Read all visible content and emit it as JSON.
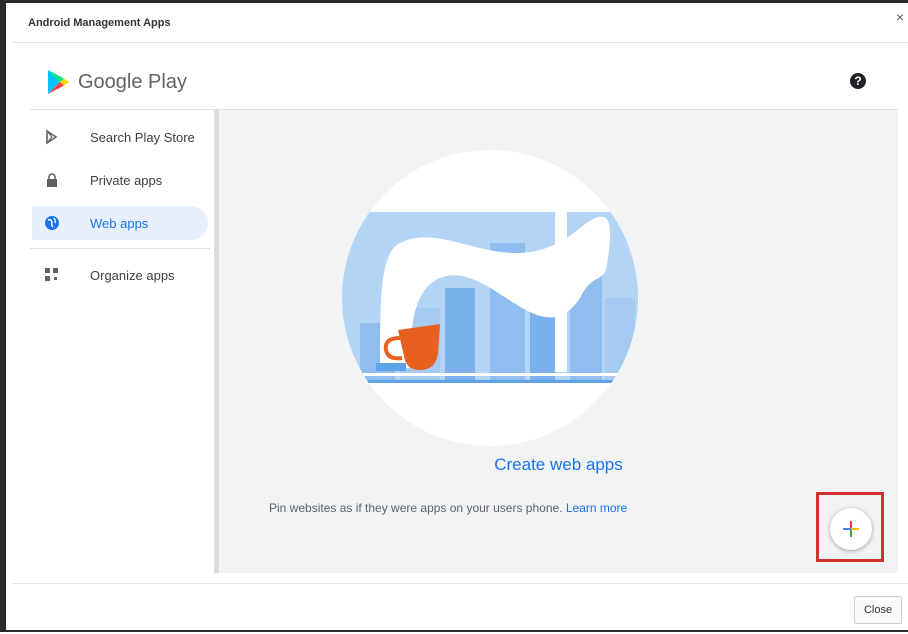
{
  "dialog": {
    "title": "Android Management Apps",
    "close_icon": "close-icon",
    "close_glyph": "×",
    "footer_close_label": "Close"
  },
  "header": {
    "brand": "Google Play",
    "logo_icon": "google-play-logo",
    "help_icon": "help-icon",
    "help_glyph": "?"
  },
  "sidebar": {
    "items": [
      {
        "label": "Search Play Store",
        "icon": "play-store-icon",
        "active": false
      },
      {
        "label": "Private apps",
        "icon": "lock-icon",
        "active": false
      },
      {
        "label": "Web apps",
        "icon": "globe-icon",
        "active": true
      },
      {
        "label": "Organize apps",
        "icon": "grid-icon",
        "active": false
      }
    ]
  },
  "main": {
    "title": "Create web apps",
    "description": "Pin websites as if they were apps on your users phone.",
    "learn_more": "Learn more",
    "fab_icon": "add-icon"
  },
  "colors": {
    "accent": "#1a73e8",
    "active_bg": "#e8f0fe",
    "highlight_border": "#d32f2f",
    "content_bg": "#f1f3f4"
  }
}
